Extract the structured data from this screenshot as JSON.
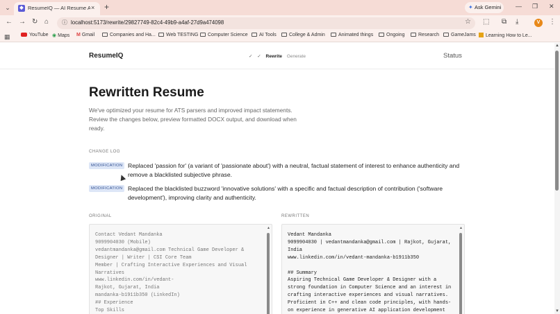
{
  "browser": {
    "tab_title": "ResumeIQ — AI Resume Analy",
    "tab_close": "×",
    "new_tab": "+",
    "url": "localhost:5173/rewrite/29827749-82c4-49b9-a4af-27d9a474098",
    "gemini_label": "Ask Gemini",
    "avatar_letter": "V",
    "bookmarks": [
      "YouTube",
      "Maps",
      "Gmail",
      "Companies and Ha...",
      "Web TESTING",
      "Computer Science",
      "AI Tools",
      "College & Admin",
      "Animated things",
      "Ongoing",
      "Research",
      "GameJams",
      "Learning How to Le..."
    ]
  },
  "app": {
    "logo": "ResumeIQ",
    "steps": {
      "check1": "✓",
      "check2": "✓",
      "rewrite": "Rewrite",
      "generate": "Generate"
    },
    "status_link": "Status"
  },
  "main": {
    "title": "Rewritten Resume",
    "description": "We've optimized your resume for ATS parsers and improved impact statements. Review the changes below, preview formatted DOCX output, and download when ready.",
    "change_log_label": "CHANGE LOG",
    "changes": [
      {
        "badge": "MODIFICATION",
        "text": "Replaced 'passion for' (a variant of 'passionate about') with a neutral, factual statement of interest to enhance authenticity and remove a blacklisted subjective phrase."
      },
      {
        "badge": "MODIFICATION",
        "text": "Replaced the blacklisted buzzword 'innovative solutions' with a specific and factual description of contribution ('software development'), improving clarity and authenticity."
      }
    ],
    "original_label": "ORIGINAL",
    "rewritten_label": "REWRITTEN",
    "original_text": "Contact Vedant Mandanka\n9099904030 (Mobile)\nvedantmandanka@gmail.com Technical Game Developer & Designer | Writer | CSI Core Team\nMember | Crafting Interactive Experiences and Visual Narratives\nwww.linkedin.com/in/vedant-\nRajkot, Gujarat, India\nmandanka-b1911b350 (LinkedIn)\n## Experience\nTop Skills",
    "rewritten_text": "Vedant Mandanka\n9099904030 | vedantmandanka@gmail.com | Rajkot, Gujarat, India\nwww.linkedin.com/in/vedant-mandanka-b1911b350\n\n## Summary\nAspiring Technical Game Developer & Designer with a strong foundation in Computer Science and an interest in crafting interactive experiences and visual narratives. Proficient in C++ and clean code principles, with hands-on experience in generative AI application development (Gemini,"
  }
}
